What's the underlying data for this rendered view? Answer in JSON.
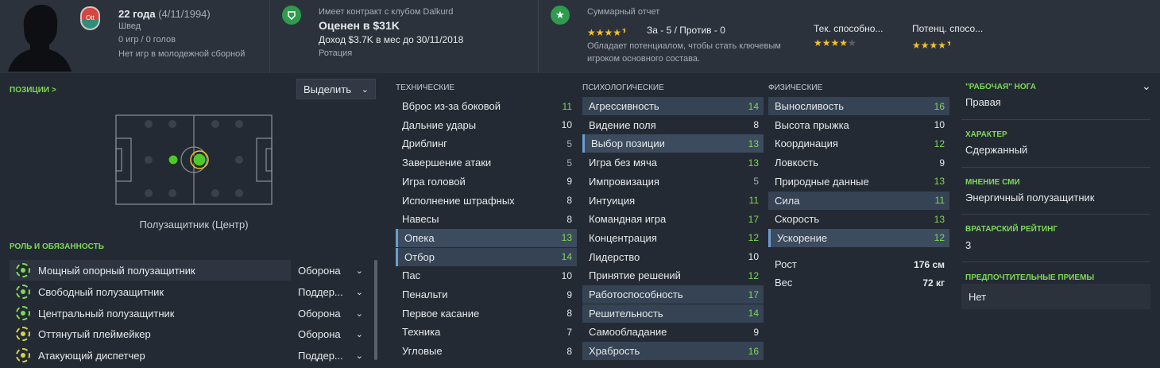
{
  "header": {
    "age": "22 года",
    "dob": "(4/11/1994)",
    "nationality": "Швед",
    "senior_caps": "0 игр / 0 голов",
    "youth_caps": "Нет игр в молодежной сборной",
    "club_badge_text": "Ott",
    "contract_text": "Имеет контракт с клубом Dalkurd",
    "value": "Оценен в $31K",
    "wage": "Доход $3.7K в мес до 30/11/2018",
    "squad_status": "Ротация",
    "report_title": "Суммарный отчет",
    "report_for_against": "За - 5 / Против - 0",
    "report_desc_line1": "Обладает потенциалом, чтобы стать ключевым",
    "report_desc_line2": "игроком основного состава.",
    "report_stars": 4.5,
    "current_ability_label": "Тек. способно...",
    "current_ability_stars": 4,
    "potential_ability_label": "Потенц. спосо...",
    "potential_ability_stars": 4.5
  },
  "positions": {
    "title": "ПОЗИЦИИ >",
    "highlight_button": "Выделить",
    "position_label": "Полузащитник (Центр)"
  },
  "roles": {
    "title": "РОЛЬ И ОБЯЗАННОСТЬ",
    "items": [
      {
        "name": "Мощный опорный полузащитник",
        "duty": "Оборона",
        "rating": "green"
      },
      {
        "name": "Свободный полузащитник",
        "duty": "Поддер...",
        "rating": "green"
      },
      {
        "name": "Центральный полузащитник",
        "duty": "Оборона",
        "rating": "green"
      },
      {
        "name": "Оттянутый плеймейкер",
        "duty": "Оборона",
        "rating": "yellow"
      },
      {
        "name": "Атакующий диспетчер",
        "duty": "Поддер...",
        "rating": "yellow"
      }
    ]
  },
  "technical": {
    "title": "ТЕХНИЧЕСКИЕ",
    "rows": [
      {
        "name": "Вброс из-за боковой",
        "value": "11"
      },
      {
        "name": "Дальние удары",
        "value": "10"
      },
      {
        "name": "Дриблинг",
        "value": "5"
      },
      {
        "name": "Завершение атаки",
        "value": "5"
      },
      {
        "name": "Игра головой",
        "value": "9"
      },
      {
        "name": "Исполнение штрафных",
        "value": "8"
      },
      {
        "name": "Навесы",
        "value": "8"
      },
      {
        "name": "Опека",
        "value": "13"
      },
      {
        "name": "Отбор",
        "value": "14"
      },
      {
        "name": "Пас",
        "value": "10"
      },
      {
        "name": "Пенальти",
        "value": "9"
      },
      {
        "name": "Первое касание",
        "value": "8"
      },
      {
        "name": "Техника",
        "value": "7"
      },
      {
        "name": "Угловые",
        "value": "8"
      }
    ]
  },
  "mental": {
    "title": "ПСИХОЛОГИЧЕСКИЕ",
    "rows": [
      {
        "name": "Агрессивность",
        "value": "14"
      },
      {
        "name": "Видение поля",
        "value": "8"
      },
      {
        "name": "Выбор позиции",
        "value": "13"
      },
      {
        "name": "Игра без мяча",
        "value": "13"
      },
      {
        "name": "Импровизация",
        "value": "5"
      },
      {
        "name": "Интуиция",
        "value": "11"
      },
      {
        "name": "Командная игра",
        "value": "17"
      },
      {
        "name": "Концентрация",
        "value": "12"
      },
      {
        "name": "Лидерство",
        "value": "10"
      },
      {
        "name": "Принятие решений",
        "value": "12"
      },
      {
        "name": "Работоспособность",
        "value": "17"
      },
      {
        "name": "Решительность",
        "value": "14"
      },
      {
        "name": "Самообладание",
        "value": "9"
      },
      {
        "name": "Храбрость",
        "value": "16"
      }
    ]
  },
  "physical": {
    "title": "ФИЗИЧЕСКИЕ",
    "rows": [
      {
        "name": "Выносливость",
        "value": "16"
      },
      {
        "name": "Высота прыжка",
        "value": "10"
      },
      {
        "name": "Координация",
        "value": "12"
      },
      {
        "name": "Ловкость",
        "value": "9"
      },
      {
        "name": "Природные данные",
        "value": "13"
      },
      {
        "name": "Сила",
        "value": "11"
      },
      {
        "name": "Скорость",
        "value": "13"
      },
      {
        "name": "Ускорение",
        "value": "12"
      }
    ],
    "height_label": "Рост",
    "height_value": "176 см",
    "weight_label": "Вес",
    "weight_value": "72 кг"
  },
  "side": {
    "foot_title": "\"РАБОЧАЯ\" НОГА",
    "foot_value": "Правая",
    "personality_title": "ХАРАКТЕР",
    "personality_value": "Сдержанный",
    "media_title": "МНЕНИЕ СМИ",
    "media_value": "Энергичный полузащитник",
    "gk_title": "ВРАТАРСКИЙ РЕЙТИНГ",
    "gk_value": "3",
    "ppm_title": "ПРЕДПОЧТИТЕЛЬНЫЕ ПРИЕМЫ",
    "ppm_value": "Нет"
  },
  "colors": {
    "accent_green": "#7ed957",
    "highlight_row": "#3c4b5e",
    "star_gold": "#f2c22b"
  }
}
